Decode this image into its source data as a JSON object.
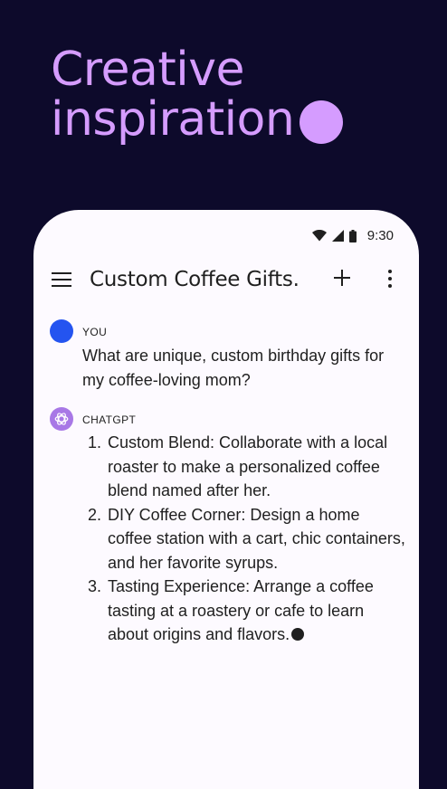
{
  "headline": {
    "line1": "Creative",
    "line2": "inspiration",
    "accent_color": "#d59cff",
    "background_color": "#0d0a2b"
  },
  "status_bar": {
    "time": "9:30",
    "icons": [
      "wifi-icon",
      "cellular-icon",
      "battery-icon"
    ]
  },
  "app_bar": {
    "title": "Custom Coffee Gifts.",
    "icons": [
      "menu-icon",
      "plus-icon",
      "more-vertical-icon"
    ]
  },
  "conversation": [
    {
      "sender": "YOU",
      "text": "What are unique, custom birthday gifts for my coffee-loving mom?",
      "avatar_color": "#2454f0"
    },
    {
      "sender": "CHATGPT",
      "avatar_icon": "openai-logo-icon",
      "avatar_color": "#a878e6",
      "items": [
        {
          "number": "1.",
          "text": "Custom Blend: Collaborate with a local roaster to make a personalized coffee blend named after her."
        },
        {
          "number": "2.",
          "text": "DIY Coffee Corner: Design a home coffee station with a cart, chic containers, and her favorite syrups."
        },
        {
          "number": "3.",
          "text": "Tasting Experience: Arrange a coffee tasting at a roastery or cafe to learn about origins and flavors."
        }
      ]
    }
  ]
}
